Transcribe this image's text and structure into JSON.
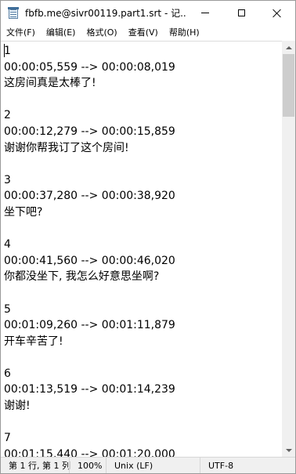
{
  "window": {
    "title": "fbfb.me@sivr00119.part1.srt - 记..."
  },
  "menu": {
    "items": [
      {
        "label": "文件(F)"
      },
      {
        "label": "编辑(E)"
      },
      {
        "label": "格式(O)"
      },
      {
        "label": "查看(V)"
      },
      {
        "label": "帮助(H)"
      }
    ]
  },
  "editor": {
    "lines": [
      "1",
      "00:00:05,559 --> 00:00:08,019",
      "这房间真是太棒了!",
      "",
      "2",
      "00:00:12,279 --> 00:00:15,859",
      "谢谢你帮我订了这个房间!",
      "",
      "3",
      "00:00:37,280 --> 00:00:38,920",
      "坐下吧?",
      "",
      "4",
      "00:00:41,560 --> 00:00:46,020",
      "你都没坐下, 我怎么好意思坐啊?",
      "",
      "5",
      "00:01:09,260 --> 00:01:11,879",
      "开车辛苦了!",
      "",
      "6",
      "00:01:13,519 --> 00:01:14,239",
      "谢谢!",
      "",
      "7",
      "00:01:15,440 --> 00:01:20,000"
    ]
  },
  "status": {
    "position": "第 1 行, 第 1 列",
    "zoom": "100%",
    "line_ending": "Unix (LF)",
    "encoding": "UTF-8"
  },
  "icons": {
    "app": "notepad-icon",
    "minimize": "minimize-icon",
    "maximize": "maximize-icon",
    "close": "close-icon"
  },
  "colors": {
    "scroll_thumb": "#cdcdcd",
    "statusbar_bg": "#f0f0f0"
  }
}
